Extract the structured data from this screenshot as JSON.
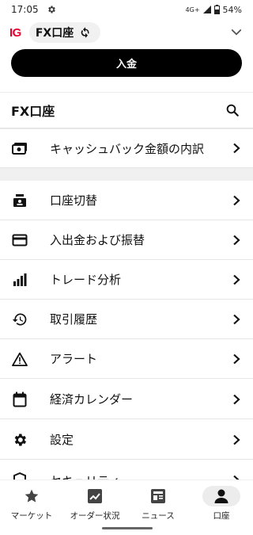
{
  "status_bar": {
    "time": "17:05",
    "network": "4G+",
    "battery": "54%"
  },
  "header": {
    "logo": "IG",
    "account_name": "FX口座"
  },
  "deposit_button": "入金",
  "account_section": {
    "title": "FX口座"
  },
  "cashback_item": {
    "label": "キャッシュバック金額の内訳",
    "icon": "cash-icon"
  },
  "menu": [
    {
      "label": "口座切替",
      "icon": "account-switch-icon"
    },
    {
      "label": "入出金および振替",
      "icon": "card-icon"
    },
    {
      "label": "トレード分析",
      "icon": "bar-chart-icon"
    },
    {
      "label": "取引履歴",
      "icon": "history-icon"
    },
    {
      "label": "アラート",
      "icon": "warning-icon"
    },
    {
      "label": "経済カレンダー",
      "icon": "calendar-icon"
    },
    {
      "label": "設定",
      "icon": "gear-icon"
    },
    {
      "label": "セキュリティ",
      "icon": "shield-icon"
    }
  ],
  "bottom_nav": [
    {
      "label": "マーケット",
      "icon": "star-icon"
    },
    {
      "label": "オーダー状況",
      "icon": "trend-icon"
    },
    {
      "label": "ニュース",
      "icon": "news-icon"
    },
    {
      "label": "口座",
      "icon": "person-icon",
      "active": true
    }
  ]
}
